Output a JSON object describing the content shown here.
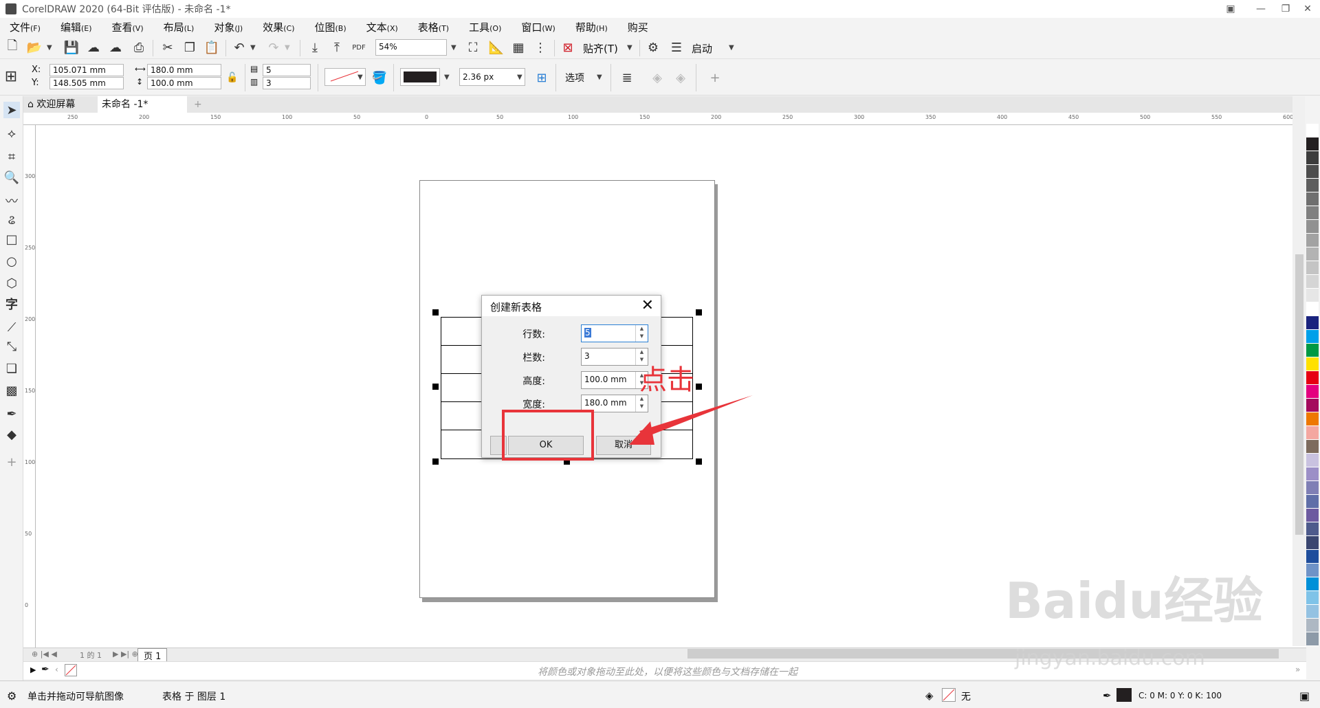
{
  "window": {
    "title": "CorelDRAW 2020 (64-Bit 评估版) - 未命名 -1*",
    "min": "—",
    "max": "❐",
    "close": "✕"
  },
  "menu": [
    {
      "label": "文件",
      "key": "(F)"
    },
    {
      "label": "编辑",
      "key": "(E)"
    },
    {
      "label": "查看",
      "key": "(V)"
    },
    {
      "label": "布局",
      "key": "(L)"
    },
    {
      "label": "对象",
      "key": "(J)"
    },
    {
      "label": "效果",
      "key": "(C)"
    },
    {
      "label": "位图",
      "key": "(B)"
    },
    {
      "label": "文本",
      "key": "(X)"
    },
    {
      "label": "表格",
      "key": "(T)"
    },
    {
      "label": "工具",
      "key": "(O)"
    },
    {
      "label": "窗口",
      "key": "(W)"
    },
    {
      "label": "帮助",
      "key": "(H)"
    },
    {
      "label": "购买",
      "key": ""
    }
  ],
  "toolbar1": {
    "zoom": "54%",
    "pdf_label": "PDF",
    "snap_label": "贴齐(T)",
    "start_label": "启动"
  },
  "props": {
    "x_label": "X:",
    "y_label": "Y:",
    "x_value": "105.071 mm",
    "y_value": "148.505 mm",
    "width": "180.0 mm",
    "height": "100.0 mm",
    "rows": "5",
    "cols": "3",
    "outline_width": "2.36 px",
    "options_label": "选项"
  },
  "tabs": {
    "welcome": "欢迎屏幕",
    "document": "未命名 -1*",
    "add": "+"
  },
  "ruler": {
    "h_ticks": [
      "250",
      "200",
      "150",
      "100",
      "50",
      "0",
      "50",
      "100",
      "150",
      "200",
      "250",
      "300",
      "350",
      "400",
      "450",
      "500",
      "550",
      "600"
    ],
    "v_ticks": [
      "300",
      "250",
      "200",
      "150",
      "100",
      "50",
      "0"
    ]
  },
  "dialog": {
    "title": "创建新表格",
    "rows_label": "行数:",
    "rows_value": "5",
    "cols_label": "栏数:",
    "cols_value": "3",
    "height_label": "高度:",
    "height_value": "100.0 mm",
    "width_label": "宽度:",
    "width_value": "180.0 mm",
    "ok_label": "OK",
    "cancel_label": "取消",
    "close": "✕"
  },
  "annotation": {
    "text": "点击",
    "color": "#e8343a"
  },
  "pagebar": {
    "page_label": "页 1",
    "pos": "1 的 1"
  },
  "docpalette": {
    "hint": "将颜色或对象拖动至此处，以便将这些颜色与文档存储在一起"
  },
  "status": {
    "nav_hint": "单击并拖动可导航图像",
    "object_info": "表格 于 图层 1",
    "fill_none": "无",
    "cmyk": "C: 0 M: 0 Y: 0 K: 100"
  },
  "palette": [
    "#ffffff",
    "#231f20",
    "#3c3c3c",
    "#4d4d4d",
    "#5e5e5e",
    "#6f6f6f",
    "#808080",
    "#919191",
    "#a2a2a2",
    "#b3b3b3",
    "#c4c4c4",
    "#d5d5d5",
    "#e6e6e6",
    "#ffffff",
    "#1a237e",
    "#00a0e9",
    "#009944",
    "#ffe100",
    "#e60012",
    "#e4007f",
    "#a40b5d",
    "#ee7800",
    "#f4a7a0",
    "#7d6b5d",
    "#c9c2e0",
    "#9c8fc7",
    "#7f7fb5",
    "#5f6ea8",
    "#6d5ba0",
    "#4e5b8c",
    "#3a4670",
    "#1f4e9c",
    "#6f93c7",
    "#0090d8",
    "#7fc3e8",
    "#94c2e2",
    "#aeb8c3",
    "#8d9aa8"
  ],
  "watermark": {
    "logo": "Baidu经验",
    "url": "jingyan.baidu.com"
  }
}
